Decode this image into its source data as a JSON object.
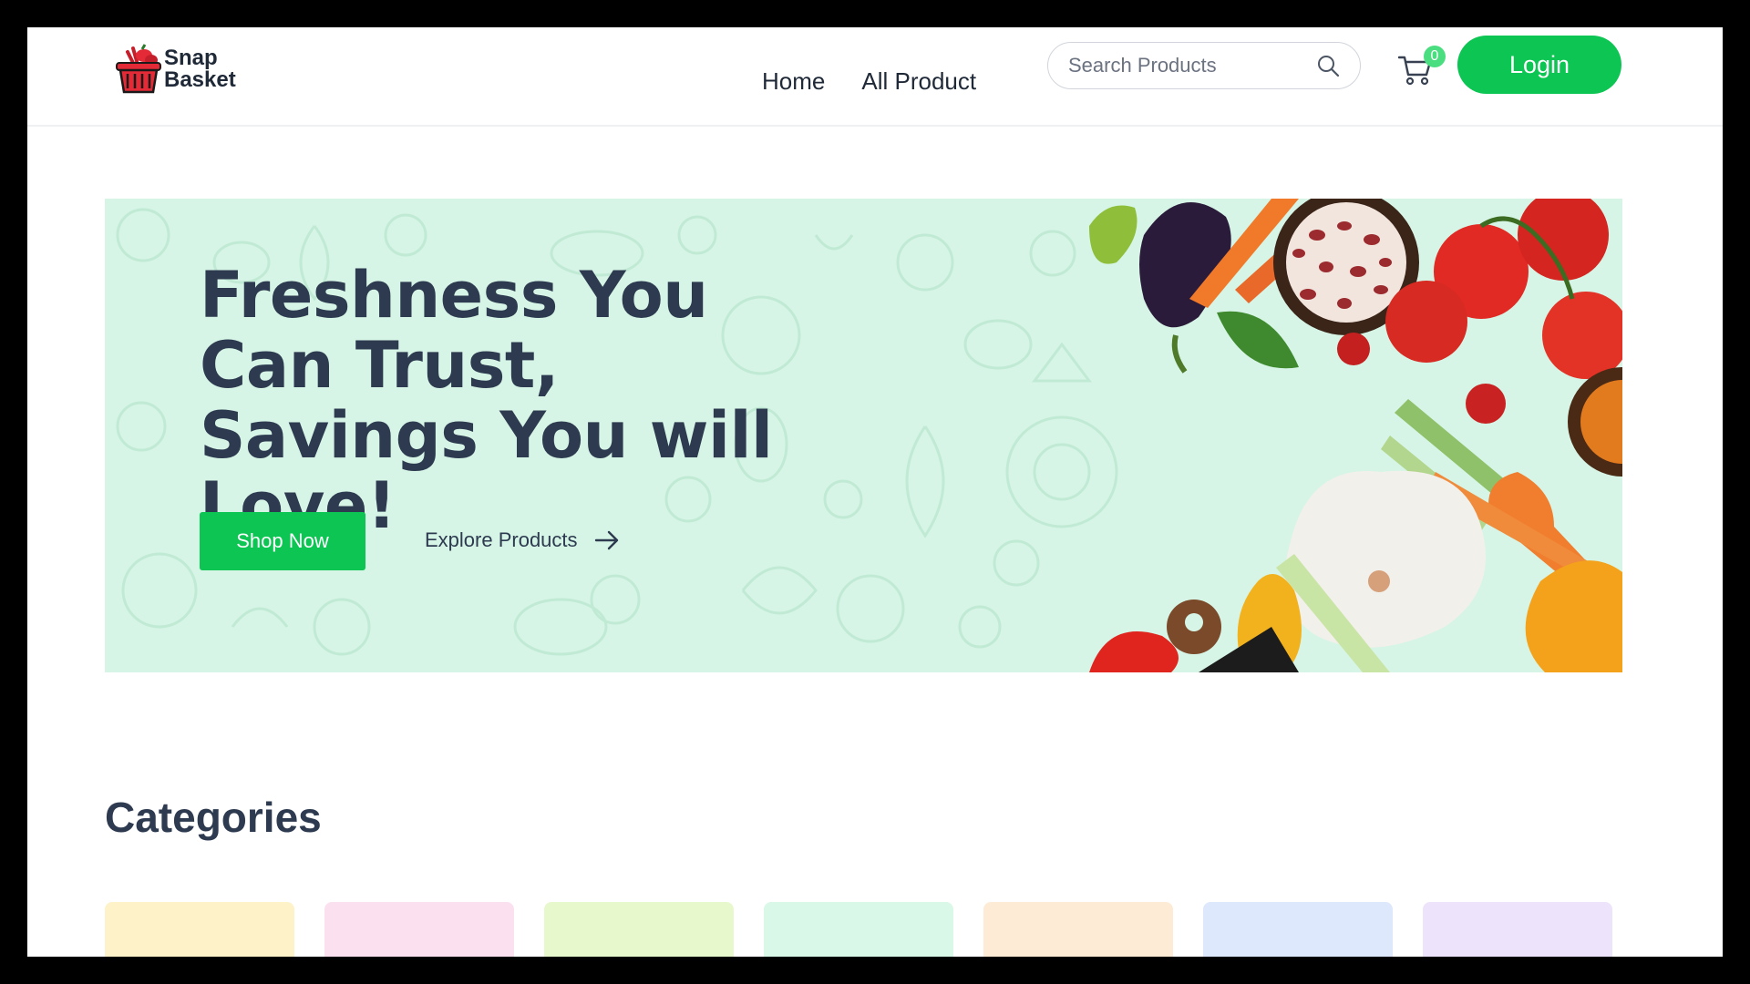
{
  "header": {
    "logo": {
      "line1": "Snap",
      "line2": "Basket"
    },
    "nav": [
      {
        "label": "Home"
      },
      {
        "label": "All Product"
      }
    ],
    "search": {
      "placeholder": "Search Products"
    },
    "cart": {
      "count": "0"
    },
    "login_label": "Login"
  },
  "hero": {
    "title": "Freshness You Can Trust, Savings You will Love!",
    "shop_now_label": "Shop Now",
    "explore_label": "Explore Products"
  },
  "categories": {
    "title": "Categories",
    "cards": [
      {
        "color": "#fdf2c8"
      },
      {
        "color": "#fbe1ef"
      },
      {
        "color": "#e8f8cd"
      },
      {
        "color": "#d9f8e8"
      },
      {
        "color": "#fdebd6"
      },
      {
        "color": "#dde8fc"
      },
      {
        "color": "#ede3fb"
      }
    ]
  },
  "colors": {
    "accent": "#0cc552",
    "hero_bg": "#d6f5e6",
    "heading": "#2d3a4f"
  },
  "icons": [
    "basket-logo-icon",
    "search-icon",
    "cart-icon",
    "arrow-right-icon"
  ]
}
